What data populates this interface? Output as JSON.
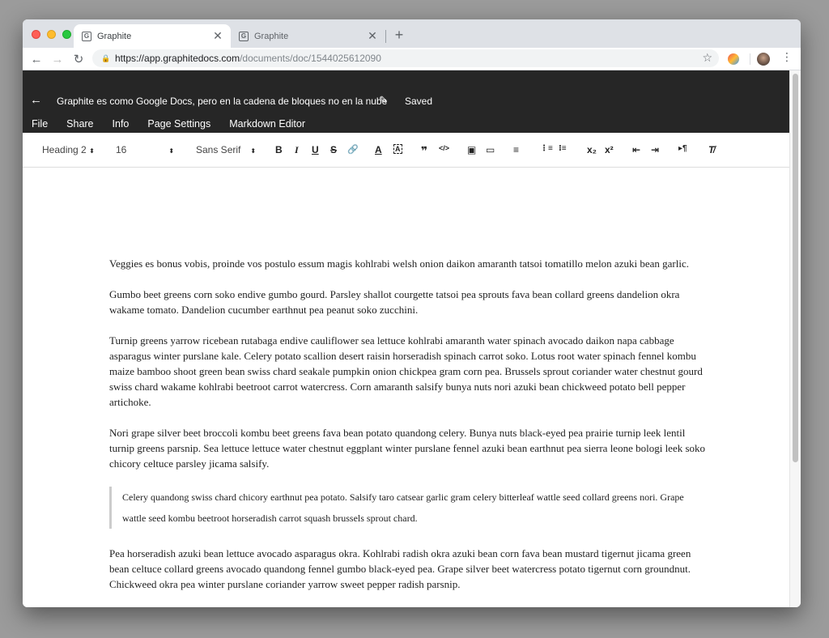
{
  "browser": {
    "tabs": [
      {
        "title": "Graphite",
        "favicon": "G",
        "active": true
      },
      {
        "title": "Graphite",
        "favicon": "G",
        "active": false
      }
    ],
    "url_host": "https://app.graphitedocs.com",
    "url_path": "/documents/doc/1544025612090"
  },
  "app": {
    "doc_title": "Graphite es como Google Docs, pero en la cadena de bloques no en la nube",
    "save_status": "Saved",
    "menu": [
      "File",
      "Share",
      "Info",
      "Page Settings",
      "Markdown Editor"
    ]
  },
  "format_toolbar": {
    "heading": "Heading 2",
    "font_size": "16",
    "font_family": "Sans Serif",
    "buttons": [
      {
        "name": "bold-button",
        "label": "B"
      },
      {
        "name": "italic-button",
        "label": "I"
      },
      {
        "name": "underline-button",
        "label": "U"
      },
      {
        "name": "strikethrough-button",
        "label": "S"
      },
      {
        "name": "link-button",
        "label": "🔗"
      },
      {
        "name": "text-color-button",
        "label": "A"
      },
      {
        "name": "highlight-button",
        "label": "A"
      },
      {
        "name": "blockquote-button",
        "label": "❞"
      },
      {
        "name": "code-button",
        "label": "</>"
      },
      {
        "name": "video-button",
        "label": "▣"
      },
      {
        "name": "image-button",
        "label": "▭"
      },
      {
        "name": "align-button",
        "label": "≡"
      },
      {
        "name": "ordered-list-button",
        "label": "⋮≡"
      },
      {
        "name": "bullet-list-button",
        "label": "⁝≡"
      },
      {
        "name": "subscript-button",
        "label": "x₂"
      },
      {
        "name": "superscript-button",
        "label": "x²"
      },
      {
        "name": "outdent-button",
        "label": "⇤"
      },
      {
        "name": "indent-button",
        "label": "⇥"
      },
      {
        "name": "text-direction-button",
        "label": "▸¶"
      },
      {
        "name": "clear-format-button",
        "label": "T̸"
      }
    ]
  },
  "document": {
    "paragraphs": [
      "Veggies es bonus vobis, proinde vos postulo essum magis kohlrabi welsh onion daikon amaranth tatsoi tomatillo melon azuki bean garlic.",
      "Gumbo beet greens corn soko endive gumbo gourd. Parsley shallot courgette tatsoi pea sprouts fava bean collard greens dandelion okra wakame tomato. Dandelion cucumber earthnut pea peanut soko zucchini.",
      "Turnip greens yarrow ricebean rutabaga endive cauliflower sea lettuce kohlrabi amaranth water spinach avocado daikon napa cabbage asparagus winter purslane kale. Celery potato scallion desert raisin horseradish spinach carrot soko. Lotus root water spinach fennel kombu maize bamboo shoot green bean swiss chard seakale pumpkin onion chickpea gram corn pea. Brussels sprout coriander water chestnut gourd swiss chard wakame kohlrabi beetroot carrot watercress. Corn amaranth salsify bunya nuts nori azuki bean chickweed potato bell pepper artichoke.",
      "Nori grape silver beet broccoli kombu beet greens fava bean potato quandong celery. Bunya nuts black-eyed pea prairie turnip leek lentil turnip greens parsnip. Sea lettuce lettuce water chestnut eggplant winter purslane fennel azuki bean earthnut pea sierra leone bologi leek soko chicory celtuce parsley jicama salsify."
    ],
    "blockquote": "Celery quandong swiss chard chicory earthnut pea potato. Salsify taro catsear garlic gram celery bitterleaf wattle seed collard greens nori. Grape wattle seed kombu beetroot horseradish carrot squash brussels sprout chard.",
    "last_paragraph": "Pea horseradish azuki bean lettuce avocado asparagus okra. Kohlrabi radish okra azuki bean corn fava bean mustard tigernut jicama green bean celtuce collard greens avocado quandong fennel gumbo black-eyed pea. Grape silver beet watercress potato tigernut corn groundnut. Chickweed okra pea winter purslane coriander yarrow sweet pepper radish parsnip."
  }
}
